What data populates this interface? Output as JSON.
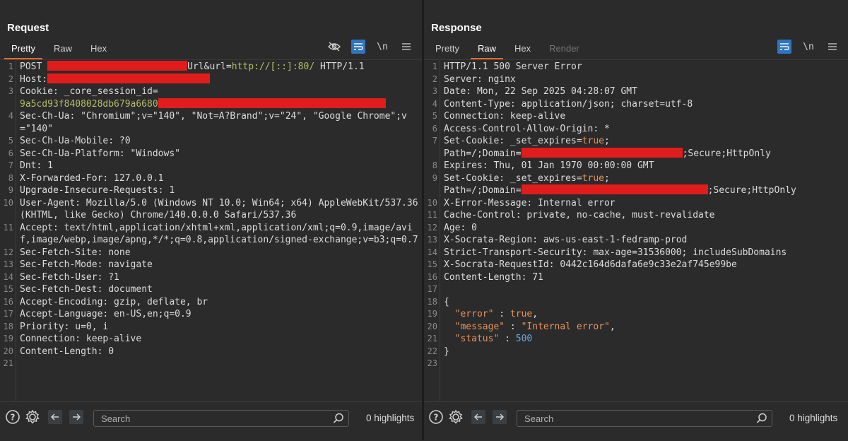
{
  "layout_buttons": [
    "split-horizontal-icon",
    "split-vertical-icon",
    "single-pane-icon"
  ],
  "request": {
    "title": "Request",
    "tabs": [
      "Pretty",
      "Raw",
      "Hex"
    ],
    "active_tab": "Pretty",
    "tools": {
      "newline_label": "\\n"
    },
    "lines": {
      "l1_a": "POST ",
      "l1_b": "Url&url=",
      "l1_c": "http://[::]:80/",
      "l1_d": " HTTP/1.1",
      "l2_k": "Host:",
      "l3_k": "Cookie:",
      "l3_v": " _core_session_id=",
      "l3_cont": "9a5cd93f8408028db679a6680",
      "l4_k": "Sec-Ch-Ua:",
      "l4_v": " \"Chromium\";v=\"140\", \"Not=A?Brand\";v=\"24\", \"Google Chrome\";v=\"140\"",
      "l5_k": "Sec-Ch-Ua-Mobile:",
      "l5_v": " ?0",
      "l6_k": "Sec-Ch-Ua-Platform:",
      "l6_v": " \"Windows\"",
      "l7_k": "Dnt:",
      "l7_v": " 1",
      "l8_k": "X-Forwarded-For:",
      "l8_v": " 127.0.0.1",
      "l9_k": "Upgrade-Insecure-Requests:",
      "l9_v": " 1",
      "l10_k": "User-Agent:",
      "l10_v": " Mozilla/5.0 (Windows NT 10.0; Win64; x64) AppleWebKit/537.36 (KHTML, like Gecko) Chrome/140.0.0.0 Safari/537.36",
      "l11_k": "Accept:",
      "l11_v": " text/html,application/xhtml+xml,application/xml;q=0.9,image/avif,image/webp,image/apng,*/*;q=0.8,application/signed-exchange;v=b3;q=0.7",
      "l12_k": "Sec-Fetch-Site:",
      "l12_v": " none",
      "l13_k": "Sec-Fetch-Mode:",
      "l13_v": " navigate",
      "l14_k": "Sec-Fetch-User:",
      "l14_v": " ?1",
      "l15_k": "Sec-Fetch-Dest:",
      "l15_v": " document",
      "l16_k": "Accept-Encoding:",
      "l16_v": " gzip, deflate, br",
      "l17_k": "Accept-Language:",
      "l17_v": " en-US,en;q=0.9",
      "l18_k": "Priority:",
      "l18_v": " u=0, i",
      "l19_k": "Connection:",
      "l19_v": " keep-alive",
      "l20_k": "Content-Length:",
      "l20_v": " 0"
    },
    "search_placeholder": "Search",
    "highlights": "0 highlights"
  },
  "response": {
    "title": "Response",
    "tabs": [
      "Pretty",
      "Raw",
      "Hex",
      "Render"
    ],
    "active_tab": "Raw",
    "tools": {
      "newline_label": "\\n"
    },
    "lines": {
      "l1": "HTTP/1.1 500 Server Error",
      "l2_k": "Server:",
      "l2_v": " nginx",
      "l3_k": "Date:",
      "l3_v": " Mon, 22 Sep 2025 04:28:07 GMT",
      "l4_k": "Content-Type:",
      "l4_v": " application/json; charset=utf-8",
      "l5_k": "Connection:",
      "l5_v": " keep-alive",
      "l6_k": "Access-Control-Allow-Origin:",
      "l6_v": " *",
      "l7_k": "Set-Cookie:",
      "l7_v": " _set_expires=",
      "l7_t": "true",
      "l7_s": ";",
      "l7_c1": "Path=/;Domain=",
      "l7_c2": ";Secure;HttpOnly",
      "l8_k": "Expires:",
      "l8_v": " Thu, 01 Jan 1970 00:00:00 GMT",
      "l9_k": "Set-Cookie:",
      "l9_v": " _set_expires=",
      "l9_t": "true",
      "l9_s": ";",
      "l9_c1": "Path=/;Domain=",
      "l9_c2": ";Secure;HttpOnly",
      "l10_k": "X-Error-Message:",
      "l10_v": " Internal error",
      "l11_k": "Cache-Control:",
      "l11_v": " private, no-cache, must-revalidate",
      "l12_k": "Age:",
      "l12_v": " 0",
      "l13_k": "X-Socrata-Region:",
      "l13_v": " aws-us-east-1-fedramp-prod",
      "l14_k": "Strict-Transport-Security:",
      "l14_v": " max-age=31536000; includeSubDomains",
      "l15_k": "X-Socrata-RequestId:",
      "l15_v": " 0442c164d6dafa6e9c33e2af745e99be",
      "l16_k": "Content-Length:",
      "l16_v": " 71",
      "l18": "{",
      "l19_k": "\"error\"",
      "l19_sep": " : ",
      "l19_v": "true",
      "l19_end": ",",
      "l20_k": "\"message\"",
      "l20_sep": " : ",
      "l20_v": "\"Internal error\"",
      "l20_end": ",",
      "l21_k": "\"status\"",
      "l21_sep": " : ",
      "l21_v": "500",
      "l22": "}"
    },
    "search_placeholder": "Search",
    "highlights": "0 highlights"
  },
  "line_numbers": {
    "request": [
      "1",
      "2",
      "3",
      "4",
      "5",
      "6",
      "7",
      "8",
      "9",
      "10",
      "11",
      "12",
      "13",
      "14",
      "15",
      "16",
      "17",
      "18",
      "19",
      "20",
      "21"
    ],
    "response": [
      "1",
      "2",
      "3",
      "4",
      "5",
      "6",
      "7",
      "8",
      "9",
      "10",
      "11",
      "12",
      "13",
      "14",
      "15",
      "16",
      "17",
      "18",
      "19",
      "20",
      "21",
      "22",
      "23"
    ]
  },
  "colors": {
    "accent_blue": "#2f75c0",
    "tab_underline": "#e86a2e",
    "redaction": "#e01c1c",
    "json_key": "#e8915b",
    "json_number": "#6ea6d8",
    "string_green": "#b5bd68"
  }
}
